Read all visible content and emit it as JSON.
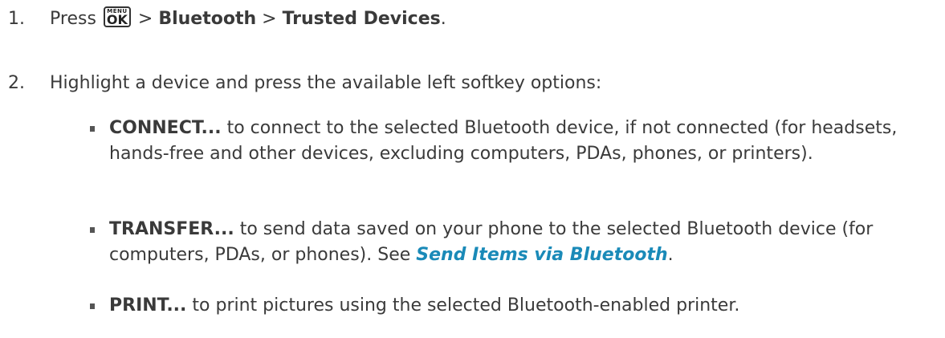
{
  "step1": {
    "num": "1.",
    "press": "Press ",
    "key_top": "MENU",
    "key_bottom": "OK",
    "sep1": " > ",
    "item1": "Bluetooth",
    "sep2": " > ",
    "item2": "Trusted Devices",
    "end": "."
  },
  "step2": {
    "num": "2.",
    "text": "Highlight a device and press the available left softkey options:"
  },
  "bullets": [
    {
      "term": "CONNECT...",
      "text": " to connect to the selected Bluetooth device, if not connected (for headsets, hands-free and other devices, excluding computers, PDAs, phones, or printers)."
    },
    {
      "term": "TRANSFER...",
      "text": " to send data saved on your phone to the selected Bluetooth device (for computers, PDAs, or phones). See ",
      "link": "Send Items via Bluetooth",
      "end": "."
    },
    {
      "term": "PRINT...",
      "text": " to print pictures using the selected Bluetooth-enabled printer."
    }
  ]
}
